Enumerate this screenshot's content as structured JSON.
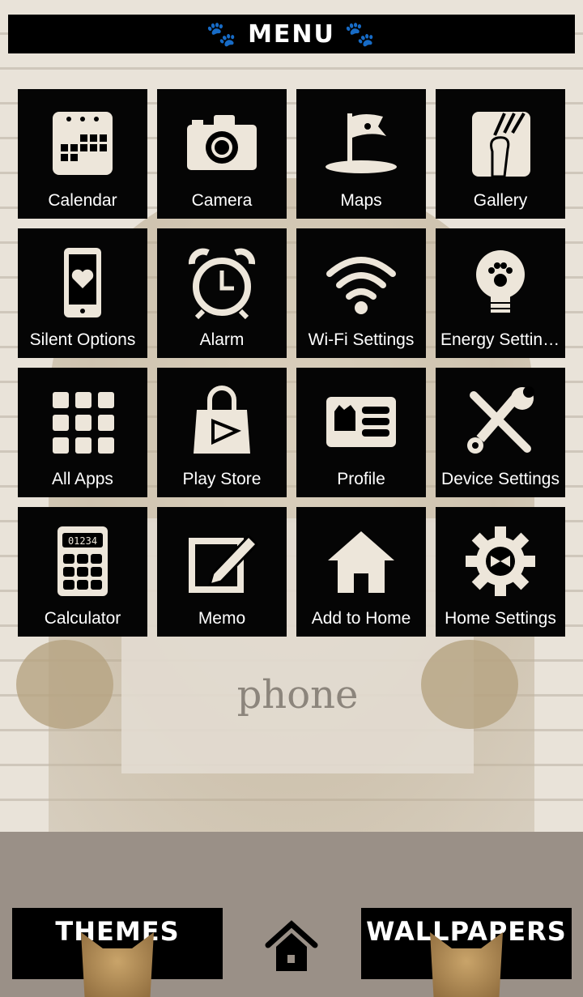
{
  "header": {
    "title": "MENU",
    "icon": "paw-icon"
  },
  "background": {
    "sign_text": "phone"
  },
  "tiles": [
    {
      "label": "Calendar",
      "icon": "calendar-icon"
    },
    {
      "label": "Camera",
      "icon": "camera-icon"
    },
    {
      "label": "Maps",
      "icon": "flag-icon"
    },
    {
      "label": "Gallery",
      "icon": "paw-scratch-icon"
    },
    {
      "label": "Silent Options",
      "icon": "phone-heart-icon"
    },
    {
      "label": "Alarm",
      "icon": "alarm-clock-icon"
    },
    {
      "label": "Wi-Fi Settings",
      "icon": "wifi-icon"
    },
    {
      "label": "Energy Settings",
      "icon": "lightbulb-icon"
    },
    {
      "label": "All Apps",
      "icon": "grid-icon"
    },
    {
      "label": "Play Store",
      "icon": "shopping-bag-play-icon"
    },
    {
      "label": "Profile",
      "icon": "id-card-icon"
    },
    {
      "label": "Device Settings",
      "icon": "tools-icon"
    },
    {
      "label": "Calculator",
      "icon": "calculator-icon"
    },
    {
      "label": "Memo",
      "icon": "edit-icon"
    },
    {
      "label": "Add to Home",
      "icon": "home-icon"
    },
    {
      "label": "Home Settings",
      "icon": "gear-icon"
    }
  ],
  "calculator_display": "01234",
  "footer": {
    "themes": "THEMES",
    "wallpapers": "WALLPAPERS",
    "home_icon": "home-icon"
  },
  "colors": {
    "tile": "#050505",
    "icon": "#ede6da",
    "footer_bg": "#9a9087"
  }
}
